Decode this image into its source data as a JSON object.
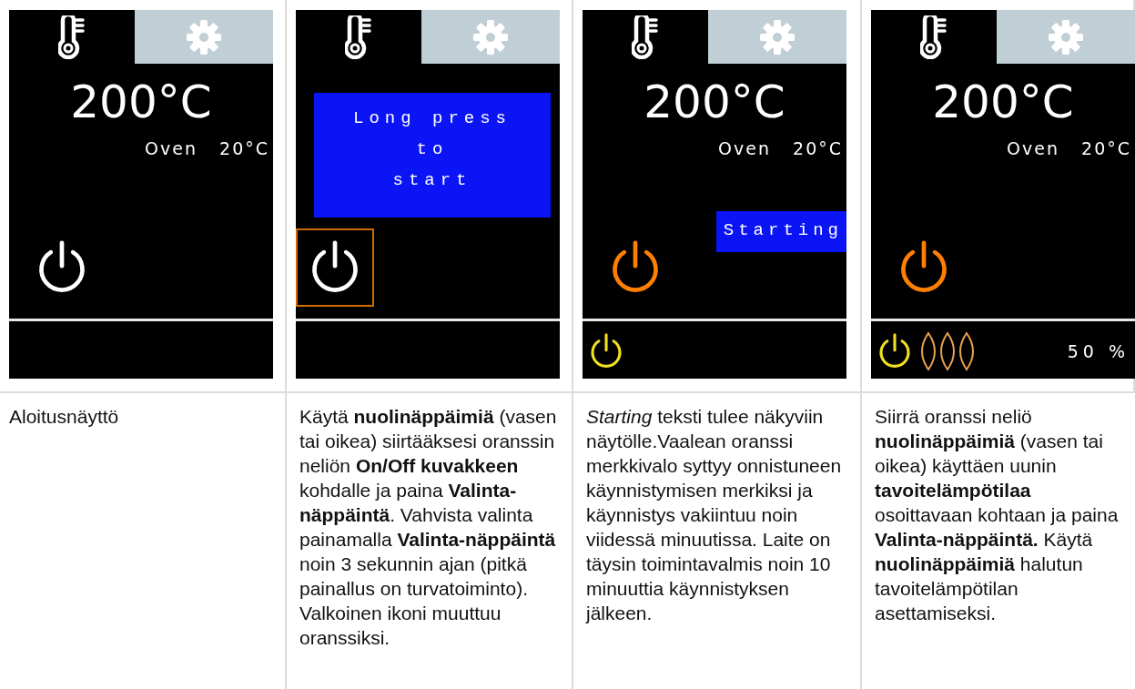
{
  "steps": [
    {
      "screen": {
        "target_temp": "200°C",
        "oven_label": "Oven",
        "oven_temp": "20°C",
        "power_on": false,
        "power_selected": false
      },
      "description": "Aloitusnäyttö"
    },
    {
      "screen": {
        "power_on": false,
        "power_selected": true,
        "message": {
          "kind": "popup",
          "text": "Long press\nto\nstart"
        }
      },
      "description": "Käytä **nuolinäppäimiä** (vasen tai oikea) siirtääksesi oranssin neliön **On/Off kuvakkeen** kohdalle ja paina **Valinta-näppäintä**. Vahvista valinta painamalla **Valinta-näppäintä** noin 3 sekunnin ajan (pitkä painallus on turvatoiminto). Valkoinen ikoni muuttuu oranssiksi."
    },
    {
      "screen": {
        "target_temp": "200°C",
        "oven_label": "Oven",
        "oven_temp": "20°C",
        "power_on": true,
        "power_selected": false,
        "message": {
          "kind": "banner",
          "text": "Starting"
        },
        "status": {
          "indicator_on": true
        }
      },
      "description": "*Starting* teksti tulee näkyviin näytölle.Vaalean oranssi merkkivalo syttyy onnistuneen käynnistymisen merkiksi ja käynnistys vakiintuu noin viidessä minuutissa. Laite on täysin toimintavalmis noin 10 minuuttia käynnistyksen jälkeen."
    },
    {
      "screen": {
        "target_temp": "200°C",
        "oven_label": "Oven",
        "oven_temp": "20°C",
        "power_on": true,
        "power_selected": false,
        "status": {
          "indicator_on": true,
          "heating": true,
          "percent": "50 %"
        }
      },
      "description": "Siirrä oranssi neliö **nuolinäppäimiä** (vasen tai oikea) käyttäen uunin **tavoitelämpötilaa** osoittavaan kohtaan ja paina **Valinta-näppäintä.** Käytä **nuolinäppäimiä** halutun tavoitelämpötilan asettamiseksi."
    }
  ]
}
